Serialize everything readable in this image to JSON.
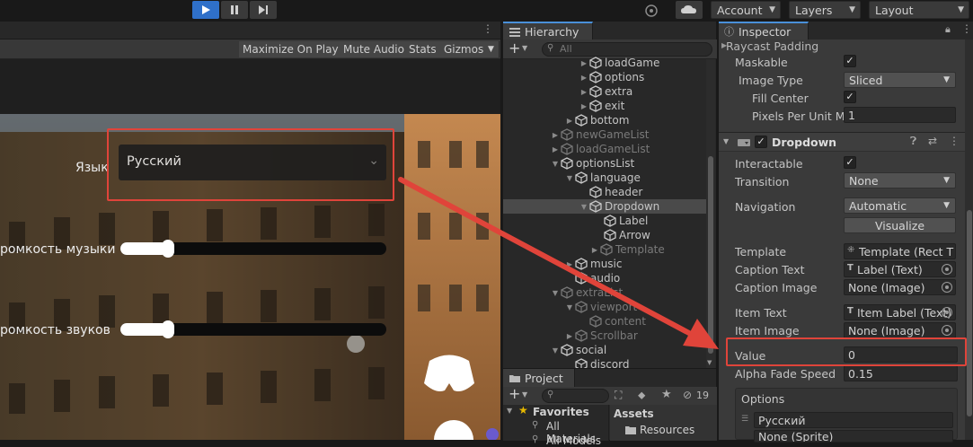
{
  "toolbar": {
    "account_label": "Account",
    "layers_label": "Layers",
    "layout_label": "Layout",
    "accent": "#2f70c9"
  },
  "game": {
    "buttons": [
      "Maximize On Play",
      "Mute Audio",
      "Stats",
      "Gizmos"
    ],
    "language_label": "Язык",
    "language_value": "Русский",
    "music_label": "ромкость музыки",
    "sound_label": "ромкость звуков",
    "music_level": 0.18,
    "sound_level": 0.18
  },
  "hierarchy": {
    "title": "Hierarchy",
    "search_placeholder": "All",
    "items": [
      {
        "label": "loadGame",
        "dim": false
      },
      {
        "label": "options",
        "dim": false
      },
      {
        "label": "extra",
        "dim": false
      },
      {
        "label": "exit",
        "dim": false
      },
      {
        "label": "bottom",
        "dim": false
      },
      {
        "label": "newGameList",
        "dim": true
      },
      {
        "label": "loadGameList",
        "dim": true
      },
      {
        "label": "optionsList",
        "dim": false
      },
      {
        "label": "language",
        "dim": false
      },
      {
        "label": "header",
        "dim": false
      },
      {
        "label": "Dropdown",
        "dim": false
      },
      {
        "label": "Label",
        "dim": false
      },
      {
        "label": "Arrow",
        "dim": false
      },
      {
        "label": "Template",
        "dim": true
      },
      {
        "label": "music",
        "dim": false
      },
      {
        "label": "audio",
        "dim": false
      },
      {
        "label": "extraList",
        "dim": true
      },
      {
        "label": "viewport",
        "dim": true
      },
      {
        "label": "content",
        "dim": true
      },
      {
        "label": "Scrollbar",
        "dim": true
      },
      {
        "label": "social",
        "dim": false
      },
      {
        "label": "discord",
        "dim": false
      }
    ]
  },
  "project": {
    "title": "Project",
    "hidden_count": "19",
    "favorites_label": "Favorites",
    "all_materials": "All Materials",
    "all_models": "All Models",
    "assets_label": "Assets",
    "resources_label": "Resources"
  },
  "inspector": {
    "title": "Inspector",
    "raycast_padding": "Raycast Padding",
    "maskable": "Maskable",
    "image_type_label": "Image Type",
    "image_type_value": "Sliced",
    "fill_center": "Fill Center",
    "ppu_label": "Pixels Per Unit Mul",
    "ppu_value": "1",
    "component_title": "Dropdown",
    "interactable": "Interactable",
    "transition_label": "Transition",
    "transition_value": "None",
    "navigation_label": "Navigation",
    "navigation_value": "Automatic",
    "visualize": "Visualize",
    "template_label": "Template",
    "template_value": "Template (Rect T",
    "caption_text_label": "Caption Text",
    "caption_text_value": "Label (Text)",
    "caption_image_label": "Caption Image",
    "caption_image_value": "None (Image)",
    "item_text_label": "Item Text",
    "item_text_value": "Item Label (Text)",
    "item_image_label": "Item Image",
    "item_image_value": "None (Image)",
    "value_label": "Value",
    "value_value": "0",
    "alpha_label": "Alpha Fade Speed",
    "alpha_value": "0.15",
    "options_label": "Options",
    "option_text": "Русский",
    "option_sprite": "None (Sprite)"
  },
  "highlight_color": "#e0443a"
}
